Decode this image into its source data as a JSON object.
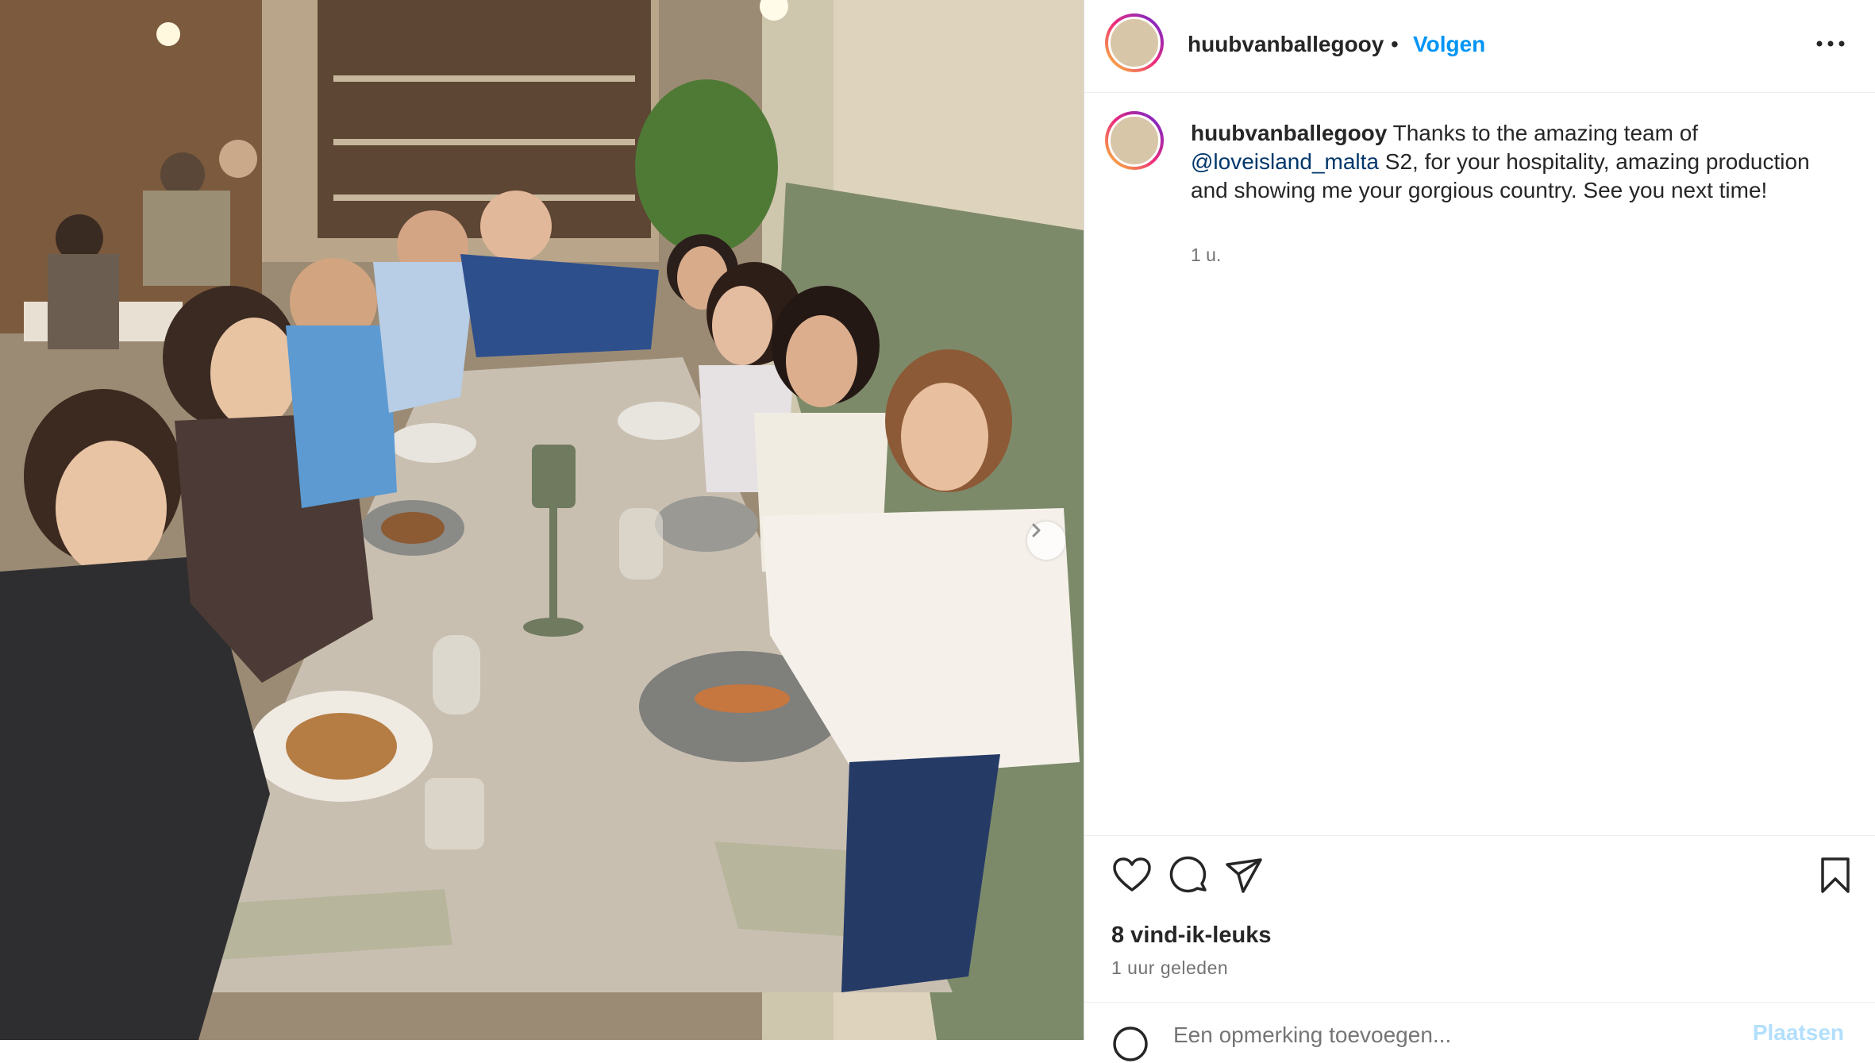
{
  "header": {
    "username": "huubvanballegooy",
    "separator": "•",
    "follow_label": "Volgen",
    "more_icon": "ellipsis-icon"
  },
  "caption": {
    "username": "huubvanballegooy",
    "text_before": " Thanks to the amazing team of",
    "mention": "@loveisland_malta",
    "text_after": " S2, for your hospitality, amazing production and showing me your gorgious country. See you next time!",
    "time": "1 u."
  },
  "actions": {
    "like_icon": "heart-icon",
    "comment_icon": "comment-icon",
    "share_icon": "send-icon",
    "save_icon": "bookmark-icon"
  },
  "likes": "8 vind-ik-leuks",
  "posted_ago": "1 uur geleden",
  "comment": {
    "placeholder": "Een opmerking toevoegen...",
    "post_label": "Plaatsen"
  },
  "photo": {
    "description_icon": "post-photo",
    "next_icon": "chevron-right-icon"
  },
  "colors": {
    "accent": "#0095f6",
    "mention": "#00376b",
    "secondary_text": "#737373"
  }
}
